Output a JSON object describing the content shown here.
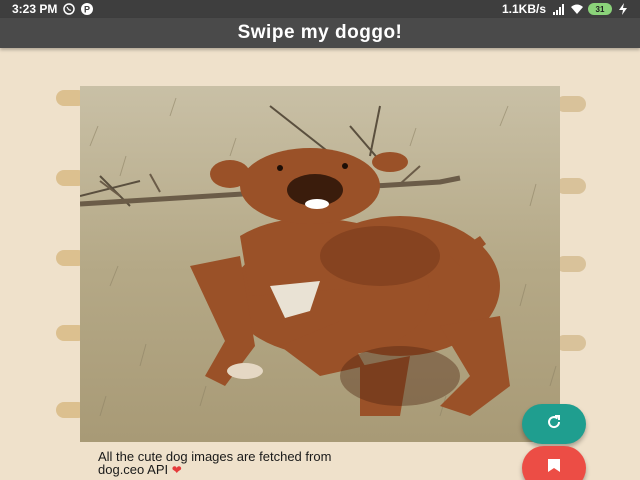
{
  "status_bar": {
    "time": "3:23 PM",
    "network_speed": "1.1KB/s",
    "battery": "31",
    "icons": [
      "whatsapp-icon",
      "p-app-icon",
      "signal-icon",
      "wifi-icon",
      "battery-icon",
      "charging-icon"
    ]
  },
  "app_bar": {
    "title": "Swipe my doggo!"
  },
  "card": {
    "image_subject": "dog-photo"
  },
  "footer": {
    "line1": "All the cute dog images are fetched from",
    "line2": "dog.ceo API",
    "heart": "❤"
  },
  "fabs": {
    "refresh_icon": "refresh-icon",
    "bookmark_icon": "bookmark-icon"
  },
  "colors": {
    "background": "#efe1cb",
    "app_bar": "#4a4a4a",
    "fab_refresh": "#1f9e8f",
    "fab_bookmark": "#ec4d45"
  }
}
